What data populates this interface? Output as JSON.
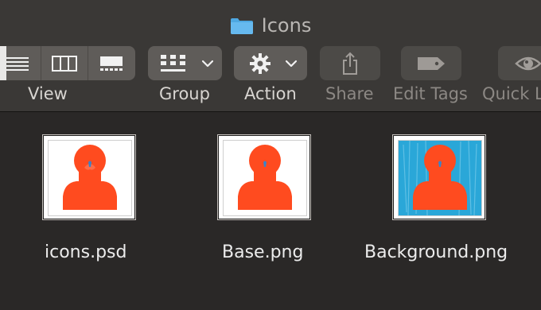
{
  "window": {
    "title": "Icons",
    "title_icon": "folder-icon"
  },
  "toolbar": {
    "view": {
      "label": "View",
      "modes": [
        {
          "name": "list-view",
          "icon": "list-view-icon"
        },
        {
          "name": "column-view",
          "icon": "column-view-icon"
        },
        {
          "name": "gallery-view",
          "icon": "gallery-view-icon"
        }
      ]
    },
    "group": {
      "label": "Group",
      "icon": "group-grid-icon",
      "menu_icon": "chevron-down-icon"
    },
    "action": {
      "label": "Action",
      "icon": "gear-icon",
      "menu_icon": "chevron-down-icon"
    },
    "share": {
      "label": "Share",
      "icon": "share-icon"
    },
    "edit_tags": {
      "label": "Edit Tags",
      "icon": "tag-icon"
    },
    "quick_look": {
      "label": "Quick L",
      "icon": "eye-icon"
    }
  },
  "files": [
    {
      "name": "icons.psd",
      "thumbnail_background": "#ffffff"
    },
    {
      "name": "Base.png",
      "thumbnail_background": "#ffffff"
    },
    {
      "name": "Background.png",
      "thumbnail_background": "#2aa7d8"
    }
  ],
  "colors": {
    "window_background": "#2a2827",
    "toolbar_background": "#3a3836",
    "toolbar_button": "#5f5c59",
    "disabled_button": "#4c4a47",
    "accent_orange": "#ff4b1f",
    "folder_blue": "#5ab0e8",
    "thumbnail_blue": "#2aa7d8"
  }
}
